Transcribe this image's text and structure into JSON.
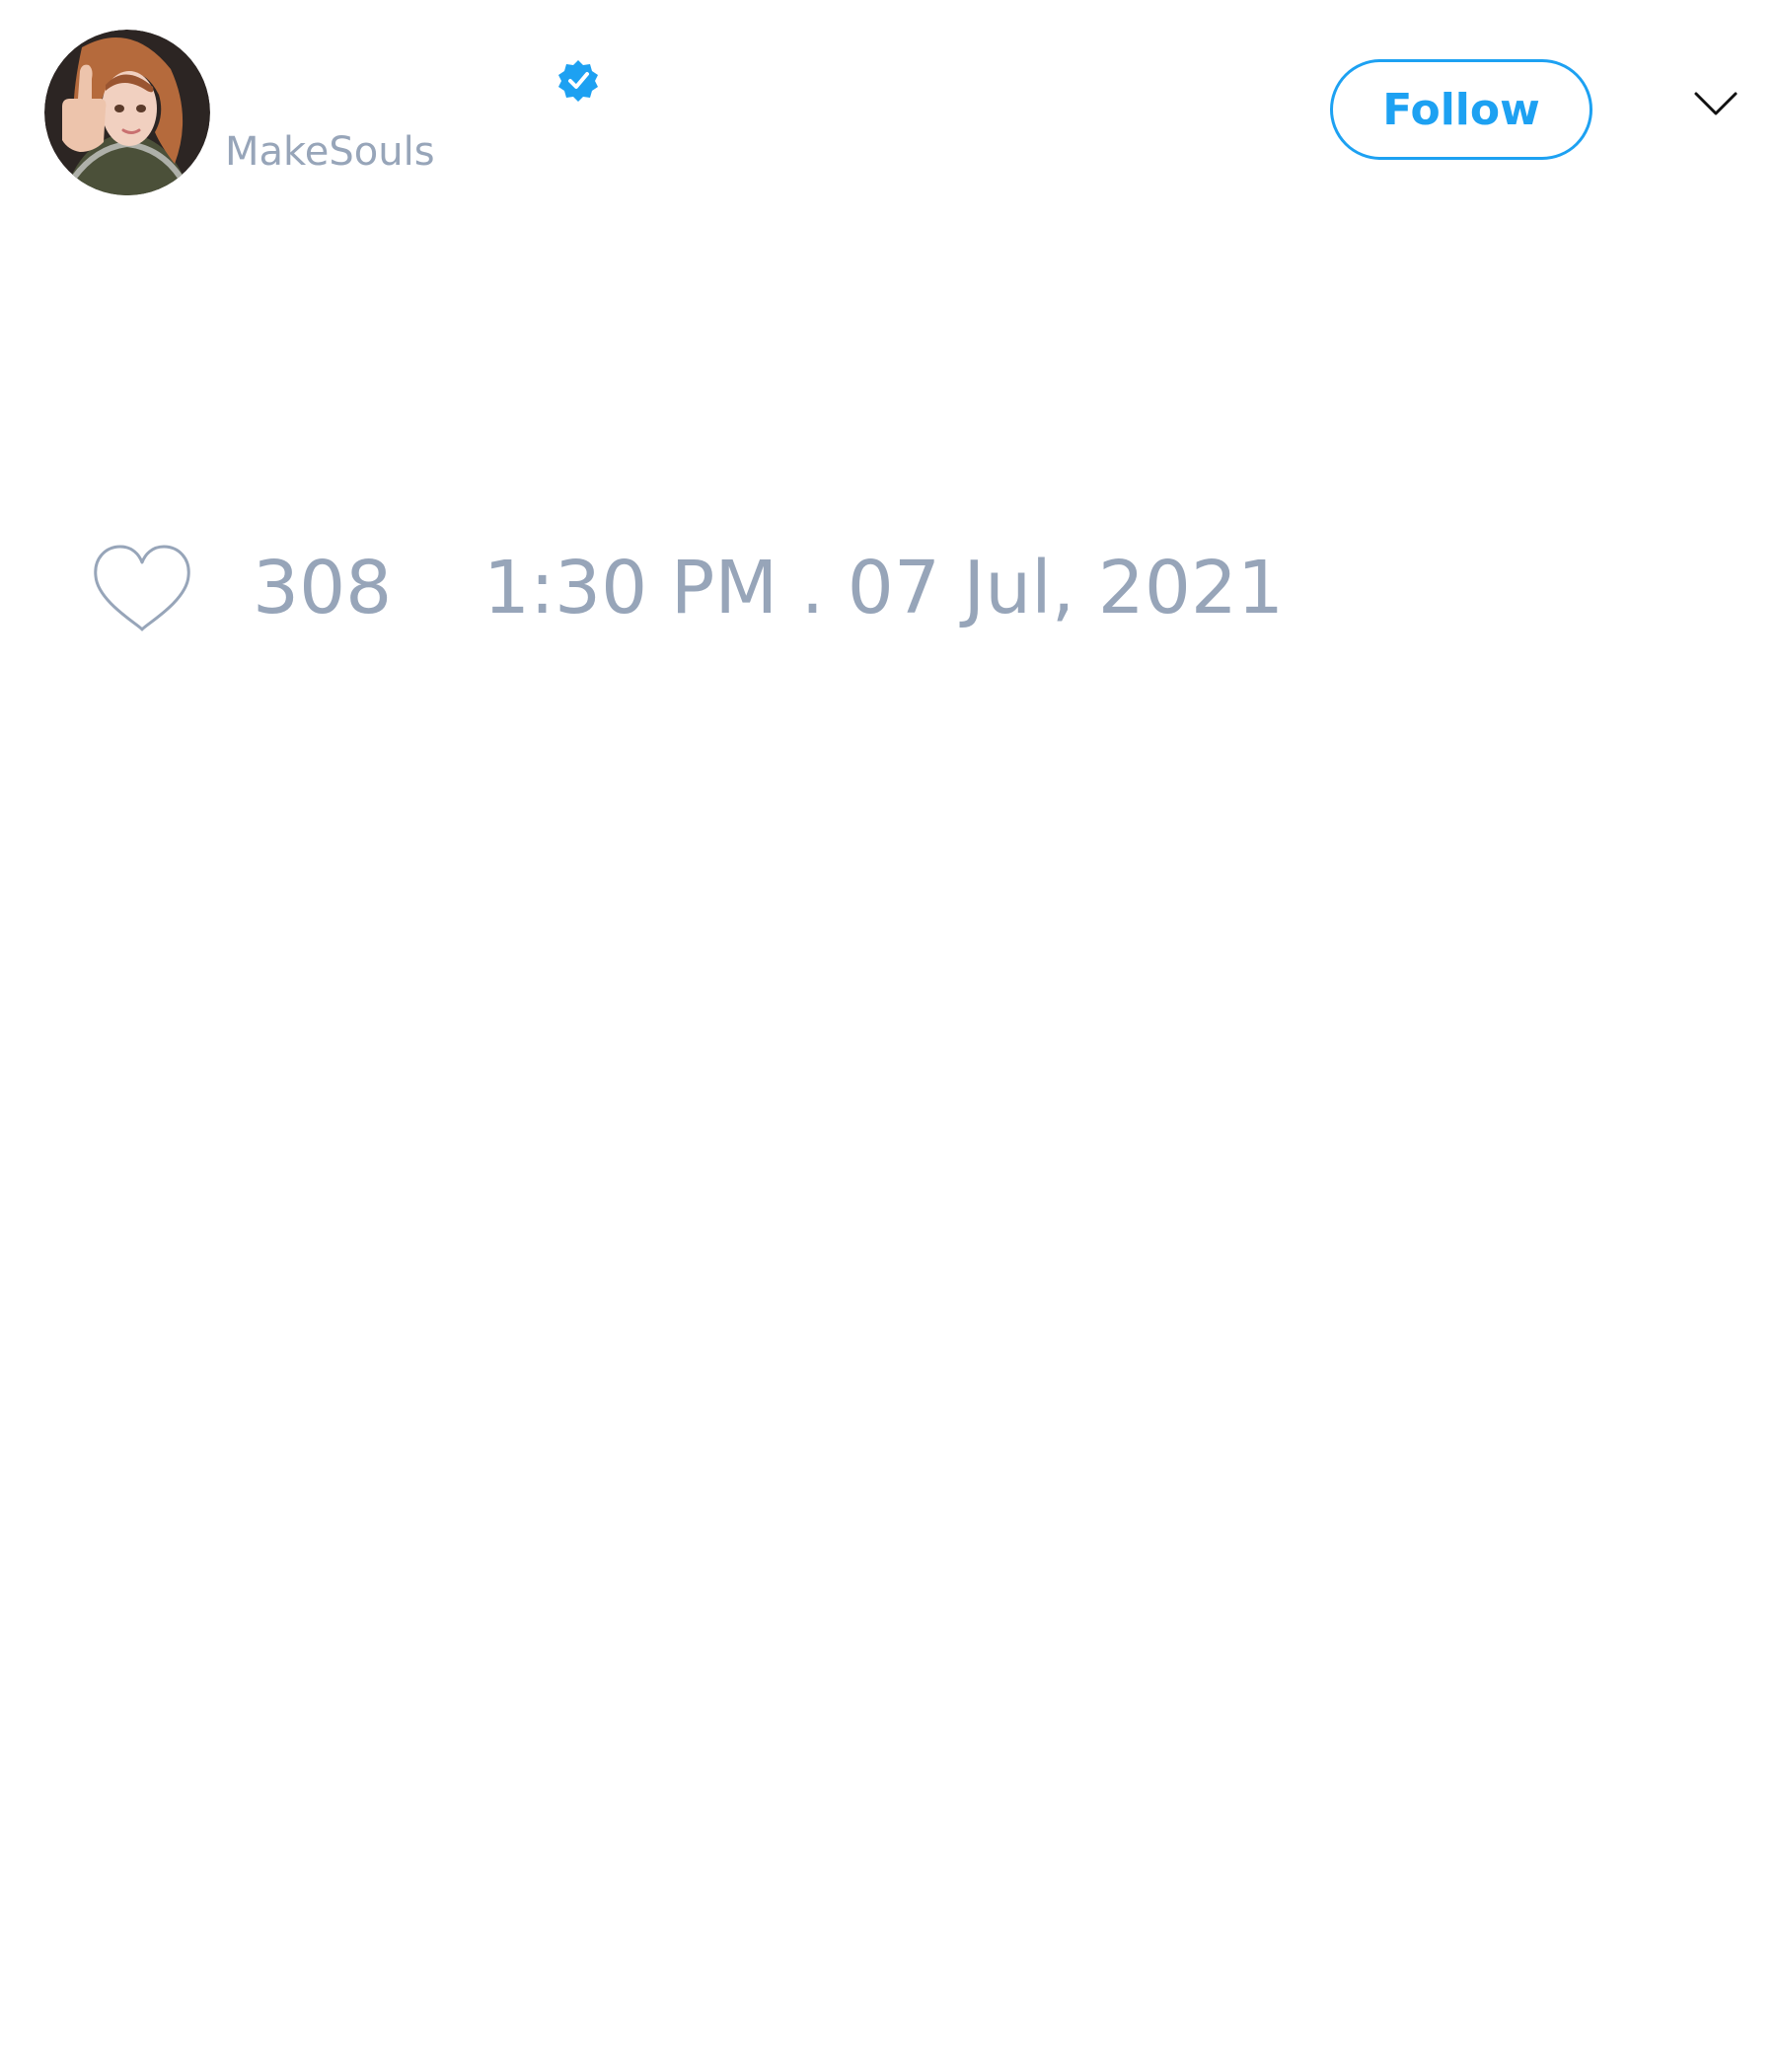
{
  "tweet": {
    "username": "MakeSouls",
    "verified": true,
    "follow_label": "Follow",
    "like_count": "308",
    "timestamp": "1:30 PM . 07 Jul, 2021"
  },
  "icons": {
    "avatar": "avatar-image",
    "verified": "verified-badge-icon",
    "menu": "chevron-down-icon",
    "like": "heart-icon"
  },
  "colors": {
    "accent": "#1da1f2",
    "muted_text": "#97a5b9",
    "menu_icon": "#111111"
  }
}
